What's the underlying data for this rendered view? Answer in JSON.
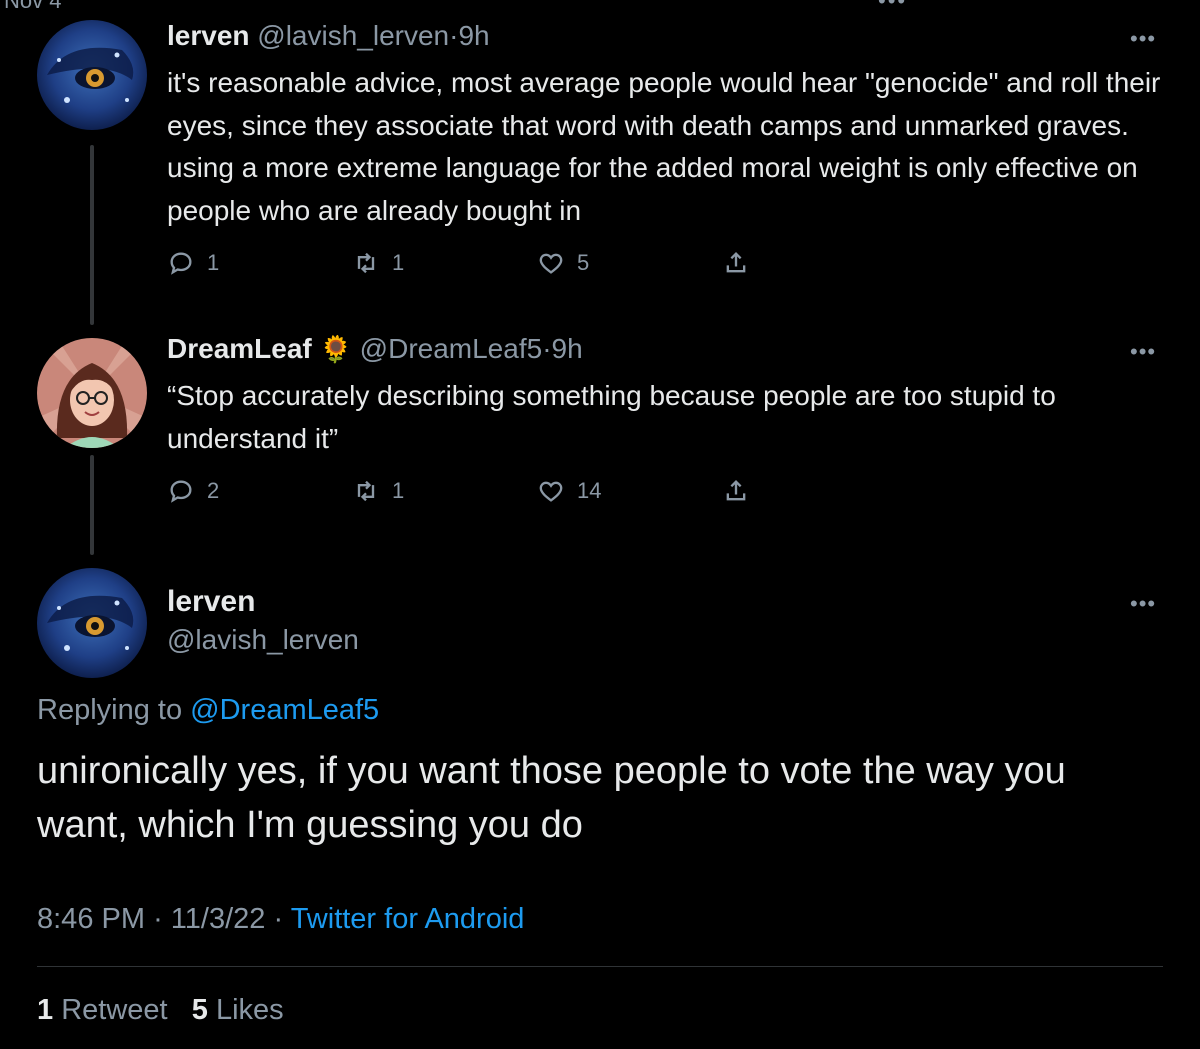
{
  "top_clip": {
    "left_text": "Nov 4",
    "right_text": "•••"
  },
  "tweets": [
    {
      "name": "lerven",
      "handle": "@lavish_lerven",
      "time": "9h",
      "text": "it's reasonable advice, most average people would hear \"genocide\" and roll their eyes, since they associate that word with death camps and unmarked graves. using a more extreme language for the added moral weight is only effective on people who are already bought in",
      "replies": "1",
      "retweets": "1",
      "likes": "5"
    },
    {
      "name": "DreamLeaf",
      "emoji": "🌻",
      "handle": "@DreamLeaf5",
      "time": "9h",
      "text": "“Stop accurately describing something because people are too stupid to understand it”",
      "replies": "2",
      "retweets": "1",
      "likes": "14"
    }
  ],
  "main_tweet": {
    "name": "lerven",
    "handle": "@lavish_lerven",
    "replying_prefix": "Replying to",
    "replying_to": "@DreamLeaf5",
    "text": "unironically yes, if you want those people to vote the way you want, which I'm guessing you do",
    "time": "8:46 PM",
    "date": "11/3/22",
    "source": "Twitter for Android",
    "retweet_count": "1",
    "retweet_label": "Retweet",
    "like_count": "5",
    "like_label": "Likes"
  },
  "more_glyph": "•••",
  "separator": "·",
  "icons": [
    "reply-icon",
    "retweet-icon",
    "like-icon",
    "share-icon",
    "more-icon"
  ],
  "colors": {
    "background": "#000000",
    "text": "#e7e9ea",
    "secondary": "#8b98a5",
    "link": "#1d9bf0",
    "divider": "#2f3336"
  }
}
